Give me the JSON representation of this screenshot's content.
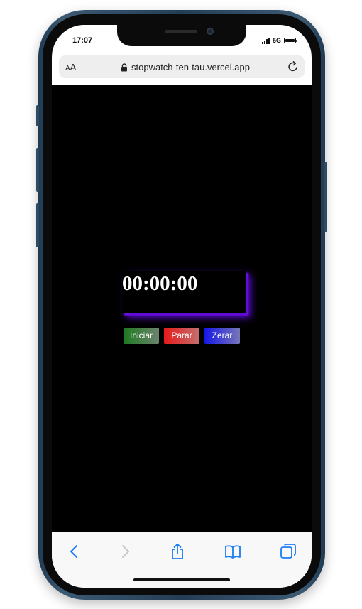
{
  "status_bar": {
    "time": "17:07",
    "network": "5G",
    "battery_level": 1.0
  },
  "browser": {
    "text_size_button": {
      "small": "A",
      "large": "A"
    },
    "url": "stopwatch-ten-tau.vercel.app",
    "icons": {
      "lock": "lock-icon",
      "reload": "reload-icon"
    }
  },
  "stopwatch": {
    "time": "00:00:00",
    "accent_color": "#6a0dff",
    "buttons": {
      "start": "Iniciar",
      "stop": "Parar",
      "reset": "Zerar"
    }
  },
  "toolbar": {
    "items": [
      "back-icon",
      "forward-icon",
      "share-icon",
      "bookmarks-icon",
      "tabs-icon"
    ],
    "active_color": "#1a7cf4",
    "disabled_color": "#c7c7cc"
  }
}
